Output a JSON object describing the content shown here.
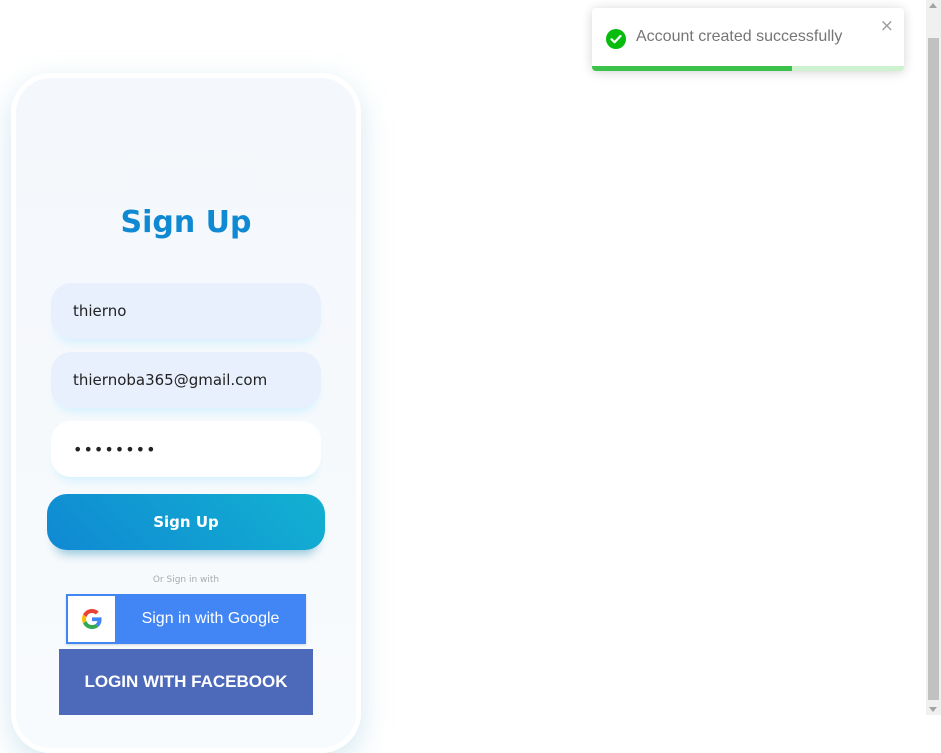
{
  "form": {
    "title": "Sign Up",
    "username_value": "thierno",
    "email_value": "thiernoba365@gmail.com",
    "password_mask": "••••••••",
    "submit_label": "Sign Up",
    "divider_text": "Or Sign in with",
    "google_label": "Sign in with Google",
    "facebook_label": "LOGIN WITH FACEBOOK"
  },
  "toast": {
    "message": "Account created successfully",
    "close_glyph": "×",
    "progress_fraction": 0.64,
    "icon": "check-circle-icon"
  },
  "colors": {
    "accent": "#1089d3",
    "success": "#3bc24a",
    "google": "#4285f4",
    "facebook": "#4c69ba"
  }
}
